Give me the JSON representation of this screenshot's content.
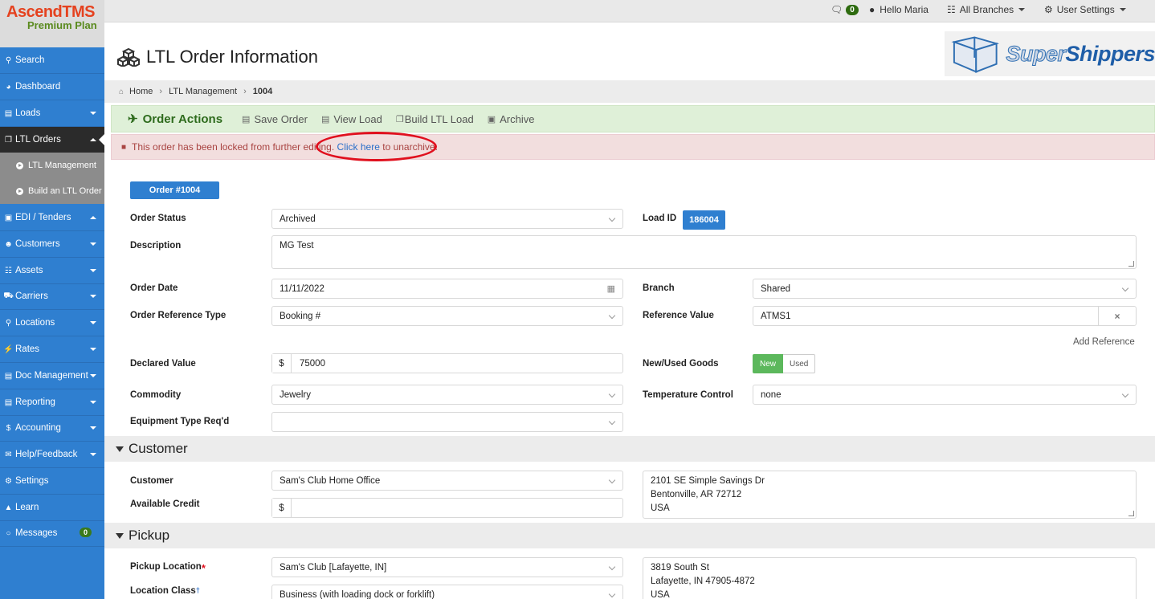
{
  "logo": {
    "main": "AscendTMS",
    "sub": "Premium Plan"
  },
  "topbar": {
    "messages_count": "0",
    "greeting": "Hello Maria",
    "branches": "All Branches",
    "user_settings": "User Settings"
  },
  "sidebar": {
    "items": [
      {
        "label": "Search",
        "icon": "search-icon"
      },
      {
        "label": "Dashboard",
        "icon": "dashboard-icon"
      },
      {
        "label": "Loads",
        "icon": "list-icon"
      },
      {
        "label": "LTL Orders",
        "icon": "cubes-icon"
      },
      {
        "label": "EDI / Tenders",
        "icon": "inbox-icon"
      },
      {
        "label": "Customers",
        "icon": "users-icon"
      },
      {
        "label": "Assets",
        "icon": "assets-icon"
      },
      {
        "label": "Carriers",
        "icon": "truck-icon"
      },
      {
        "label": "Locations",
        "icon": "map-marker-icon"
      },
      {
        "label": "Rates",
        "icon": "bolt-icon"
      },
      {
        "label": "Doc Management",
        "icon": "file-icon"
      },
      {
        "label": "Reporting",
        "icon": "report-icon"
      },
      {
        "label": "Accounting",
        "icon": "dollar-icon"
      },
      {
        "label": "Help/Feedback",
        "icon": "bullhorn-icon"
      },
      {
        "label": "Settings",
        "icon": "gears-icon"
      },
      {
        "label": "Learn",
        "icon": "graduation-icon"
      },
      {
        "label": "Messages",
        "icon": "chat-icon",
        "badge": "0"
      }
    ],
    "sub_items": [
      "LTL Management",
      "Build an LTL Order"
    ]
  },
  "header": {
    "title": "LTL Order Information",
    "brand_part1": "Super",
    "brand_part2": "Shippers"
  },
  "breadcrumb": [
    "Home",
    "LTL Management",
    "1004"
  ],
  "actions": {
    "title": "Order Actions",
    "items": [
      "Save Order",
      "View Load",
      "Build LTL Load",
      "Archive"
    ]
  },
  "alert": {
    "text": "This order has been locked from further editing.",
    "link": "Click here",
    "suffix": "to unarchive."
  },
  "order": {
    "button": "Order #1004",
    "labels": {
      "status": "Order Status",
      "load_id": "Load ID",
      "description": "Description",
      "order_date": "Order Date",
      "branch": "Branch",
      "ref_type": "Order Reference Type",
      "ref_value": "Reference Value",
      "declared_value": "Declared Value",
      "goods": "New/Used Goods",
      "commodity": "Commodity",
      "temp": "Temperature Control",
      "equipment": "Equipment Type Req'd"
    },
    "status": "Archived",
    "load_id": "186004",
    "description": "MG Test",
    "order_date": "11/11/2022",
    "branch": "Shared",
    "ref_type": "Booking #",
    "ref_value": "ATMS1",
    "add_reference": "Add Reference",
    "currency": "$",
    "declared_value": "75000",
    "goods_new": "New",
    "goods_used": "Used",
    "commodity": "Jewelry",
    "temp": "none",
    "equipment": ""
  },
  "customer": {
    "section": "Customer",
    "label_customer": "Customer",
    "label_credit": "Available Credit",
    "name": "Sam's Club Home Office",
    "credit": "",
    "address": [
      "2101 SE Simple Savings Dr",
      "Bentonville, AR 72712",
      "USA"
    ]
  },
  "pickup": {
    "section": "Pickup",
    "label_location": "Pickup Location",
    "label_class": "Location Class",
    "location": "Sam's Club [Lafayette, IN]",
    "class": "Business (with loading dock or forklift)",
    "address": [
      "3819 South St",
      "Lafayette, IN 47905-4872",
      "USA"
    ]
  },
  "colors": {
    "sidebar": "#2f7fd0",
    "accent_green": "#2e6b1d",
    "alert_red": "#a94442",
    "highlight": "#e0101e"
  }
}
